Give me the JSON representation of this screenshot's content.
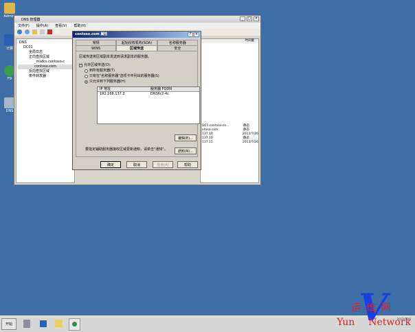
{
  "desktop": {
    "icons": [
      {
        "label": "Admini"
      },
      {
        "label": "计算"
      },
      {
        "label": "F9"
      },
      {
        "label": "DNS"
      }
    ]
  },
  "window": {
    "title": "DNS 管理器",
    "menu": [
      "文件(F)",
      "操作(A)",
      "查看(V)",
      "帮助(H)"
    ],
    "tree": [
      "DNS",
      "DC01",
      "全局日志",
      "正向查找区域",
      "_msdcs.contoso.c",
      "contoso.com",
      "反向查找区域",
      "条件转发器"
    ],
    "list": {
      "header": "时间戳",
      "rows": [
        [
          "DC1.contoso.co...",
          "静态"
        ],
        [
          "ntoso.com.",
          "静态"
        ],
        [
          "137.10",
          "2013/7/26"
        ],
        [
          "137.10",
          "静态"
        ],
        [
          "137.11",
          "2013/7/26"
        ]
      ]
    }
  },
  "dialog": {
    "title": "contoso.com 属性",
    "tabs_row1": [
      "常规",
      "起始授权机构(SOA)",
      "名称服务器"
    ],
    "tabs_row2": [
      "WINS",
      "区域传送",
      "安全"
    ],
    "description": "区域传送将区域副本发送到请求副本的服务器。",
    "allow_label": "允许区域传送(O):",
    "radios": [
      "到所有服务器(T)",
      "只有在\"名称服务器\"选项卡中列出的服务器(S)",
      "只允许到下列服务器(H)"
    ],
    "table": {
      "headers": [
        "IP 地址",
        "服务器 FQDN"
      ],
      "rows": [
        [
          "192.168.137.2",
          "DNS6r2-4c"
        ]
      ]
    },
    "edit": "编辑(E)...",
    "notify_text": "要指定辅助服务器接收区域更新通知，请单击\"通知\"。",
    "notify": "通知(N)...",
    "ok": "确定",
    "cancel": "取消",
    "apply": "应用(A)",
    "help": "帮助"
  },
  "taskbar": {
    "start": "开始",
    "clock": "2013/7/26"
  },
  "watermark": {
    "cn": "运维网",
    "en_left": "Yun",
    "en_right": "Network"
  }
}
